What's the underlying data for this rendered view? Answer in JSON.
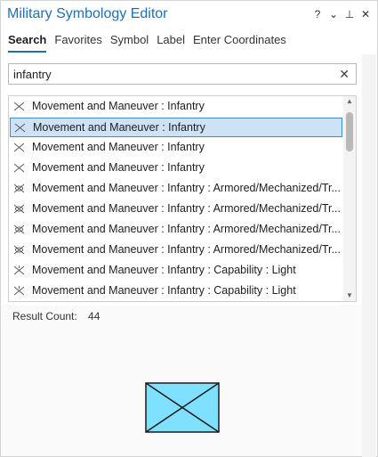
{
  "window": {
    "title": "Military Symbology Editor",
    "controls": [
      "?",
      "⌄",
      "⊥",
      "✕"
    ]
  },
  "tabs": [
    {
      "label": "Search",
      "active": true
    },
    {
      "label": "Favorites",
      "active": false
    },
    {
      "label": "Symbol",
      "active": false
    },
    {
      "label": "Label",
      "active": false
    },
    {
      "label": "Enter Coordinates",
      "active": false
    }
  ],
  "search": {
    "value": "infantry",
    "clear_icon": "close-icon"
  },
  "results": [
    {
      "text": "Movement and Maneuver : Infantry",
      "selected": false,
      "icon": "infantry-symbol-icon"
    },
    {
      "text": "Movement and Maneuver : Infantry",
      "selected": true,
      "icon": "infantry-symbol-icon"
    },
    {
      "text": "Movement and Maneuver : Infantry",
      "selected": false,
      "icon": "infantry-symbol-icon"
    },
    {
      "text": "Movement and Maneuver : Infantry",
      "selected": false,
      "icon": "infantry-symbol-icon"
    },
    {
      "text": "Movement and Maneuver : Infantry : Armored/Mechanized/Tr...",
      "selected": false,
      "icon": "armored-infantry-symbol-icon"
    },
    {
      "text": "Movement and Maneuver : Infantry : Armored/Mechanized/Tr...",
      "selected": false,
      "icon": "armored-infantry-symbol-icon"
    },
    {
      "text": "Movement and Maneuver : Infantry : Armored/Mechanized/Tr...",
      "selected": false,
      "icon": "armored-infantry-symbol-icon"
    },
    {
      "text": "Movement and Maneuver : Infantry : Armored/Mechanized/Tr...",
      "selected": false,
      "icon": "armored-infantry-symbol-icon"
    },
    {
      "text": "Movement and Maneuver : Infantry : Capability : Light",
      "selected": false,
      "icon": "light-infantry-symbol-icon"
    },
    {
      "text": "Movement and Maneuver : Infantry : Capability : Light",
      "selected": false,
      "icon": "light-infantry-symbol-icon"
    }
  ],
  "result_count": {
    "label": "Result Count:",
    "value": "44"
  },
  "preview": {
    "icon": "infantry-symbol-preview",
    "fill": "#80e0ff",
    "stroke": "#1a1a1a"
  },
  "colors": {
    "accent": "#1e6fb5",
    "selection_bg": "#cde3f5",
    "selection_border": "#3b8dd0"
  }
}
